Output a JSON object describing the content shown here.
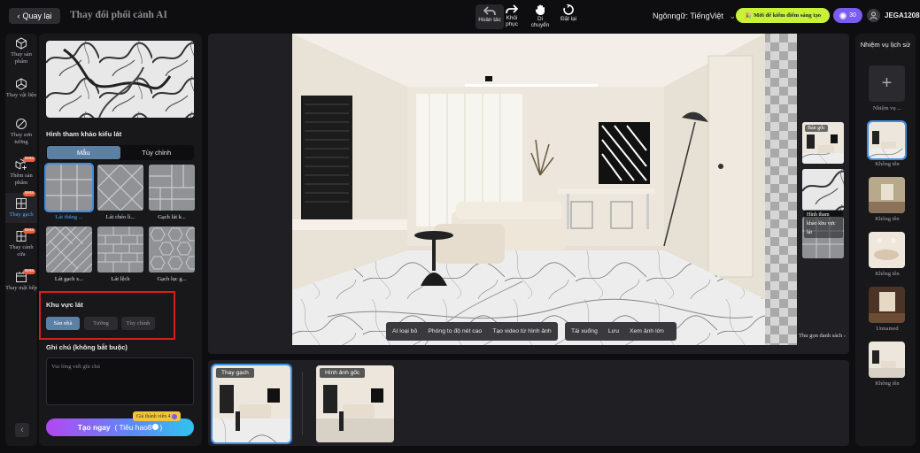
{
  "topbar": {
    "back_label": "Quay lại",
    "title": "Thay đổi phối cảnh AI",
    "tools": [
      {
        "label": "Hoàn tác",
        "icon": "undo-icon"
      },
      {
        "label": "Khôi phục",
        "icon": "redo-icon"
      },
      {
        "label": "Di chuyển",
        "icon": "hand-icon"
      },
      {
        "label": "Đặt lại",
        "icon": "reset-icon"
      }
    ],
    "language": "Ngônngữ: TiếngViệt",
    "promo": "Mời để kiếm điểm sáng tạo",
    "credits": "30",
    "username": "JEGA1208"
  },
  "leftnav": {
    "items": [
      {
        "label": "Thay sản phẩm",
        "icon": "replace-product-icon",
        "beta": ""
      },
      {
        "label": "Thay vật liệu",
        "icon": "material-icon",
        "beta": ""
      },
      {
        "label": "Thay sơn tường",
        "icon": "paint-icon",
        "beta": ""
      },
      {
        "label": "Thêm sản phẩm",
        "icon": "add-product-icon",
        "beta": "Beta"
      },
      {
        "label": "Thay gạch",
        "icon": "tile-icon",
        "beta": "Beta"
      },
      {
        "label": "Thay cánh cửa",
        "icon": "door-icon",
        "beta": "Beta"
      },
      {
        "label": "Thay mặt bếp",
        "icon": "kitchen-icon",
        "beta": "Beta"
      }
    ]
  },
  "panel": {
    "ref_heading": "Hình tham khảo kiểu lát",
    "seg_sample": "Mẫu",
    "seg_custom": "Tùy chỉnh",
    "tiles": [
      {
        "label": "Lát thẳng ..."
      },
      {
        "label": "Lát chéo lì..."
      },
      {
        "label": "Gạch lát k..."
      },
      {
        "label": "Lát gạch x..."
      },
      {
        "label": "Lát lệch"
      },
      {
        "label": "Gạch lục g..."
      }
    ],
    "area_heading": "Khu vực lát",
    "area_options": [
      "Sàn nhà",
      "Tường",
      "Tùy chỉnh"
    ],
    "note_heading": "Ghi chú (không bắt buộc)",
    "note_placeholder": "Vui lòng viết ghi chú",
    "create_label": "Tạo ngay",
    "create_cost": "( Tiêu hao8",
    "create_cost_end": ")",
    "member_tag": "Giá thành viên 4"
  },
  "canvas": {
    "actions_left": [
      "AI loại bỏ",
      "Phóng to độ nét cao",
      "Tạo video từ hình ảnh"
    ],
    "actions_right": [
      "Tải xuống",
      "Lưu",
      "Xem ảnh lớn"
    ],
    "side_original": "Bản gốc",
    "side_reference": "Hình tham khảo khu vực lát",
    "collapse_list": "Thu gọn danh sách"
  },
  "results": [
    {
      "label": "Thay gạch"
    },
    {
      "label": "Hình ảnh gốc"
    }
  ],
  "history": {
    "title": "Nhiệm vụ lịch sử",
    "new_task": "Nhiệm vụ ...",
    "items": [
      "Không tên",
      "Không tên",
      "Không tên",
      "Unnamed",
      "Không tên"
    ]
  }
}
